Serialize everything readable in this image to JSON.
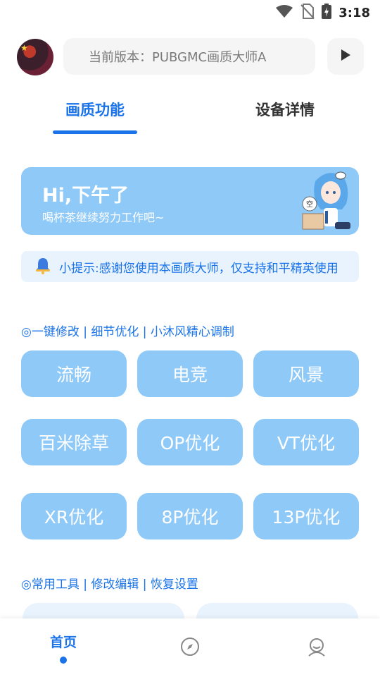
{
  "status_bar": {
    "time": "3:18",
    "icons": [
      "wifi-icon",
      "no-sim-icon",
      "battery-charging-icon"
    ]
  },
  "header": {
    "version_text": "当前版本：PUBGMC画质大师A",
    "avatar_icon": "avatar",
    "play_icon": "play-icon"
  },
  "tabs": [
    {
      "label": "画质功能",
      "active": true
    },
    {
      "label": "设备详情",
      "active": false
    }
  ],
  "banner": {
    "title": "Hi,下午了",
    "subtitle": "喝杯茶继续努力工作吧~",
    "art_caption": "空"
  },
  "tip": {
    "icon": "bell-icon",
    "text": "小提示:感谢您使用本画质大师，仅支持和平精英使用"
  },
  "section_quality": {
    "title": "◎一键修改 | 细节优化 | 小沐风精心调制",
    "options": [
      "流畅",
      "电竞",
      "风景",
      "百米除草",
      "OP优化",
      "VT优化",
      "XR优化",
      "8P优化",
      "13P优化"
    ]
  },
  "section_tools": {
    "title": "◎常用工具 | 修改编辑 | 恢复设置"
  },
  "bottom_nav": {
    "home_label": "首页",
    "explore_icon": "compass-icon",
    "profile_icon": "user-icon"
  },
  "colors": {
    "accent": "#1a73e8",
    "button_bg": "#8ec9f8",
    "tip_bg": "#e9f3fd"
  }
}
